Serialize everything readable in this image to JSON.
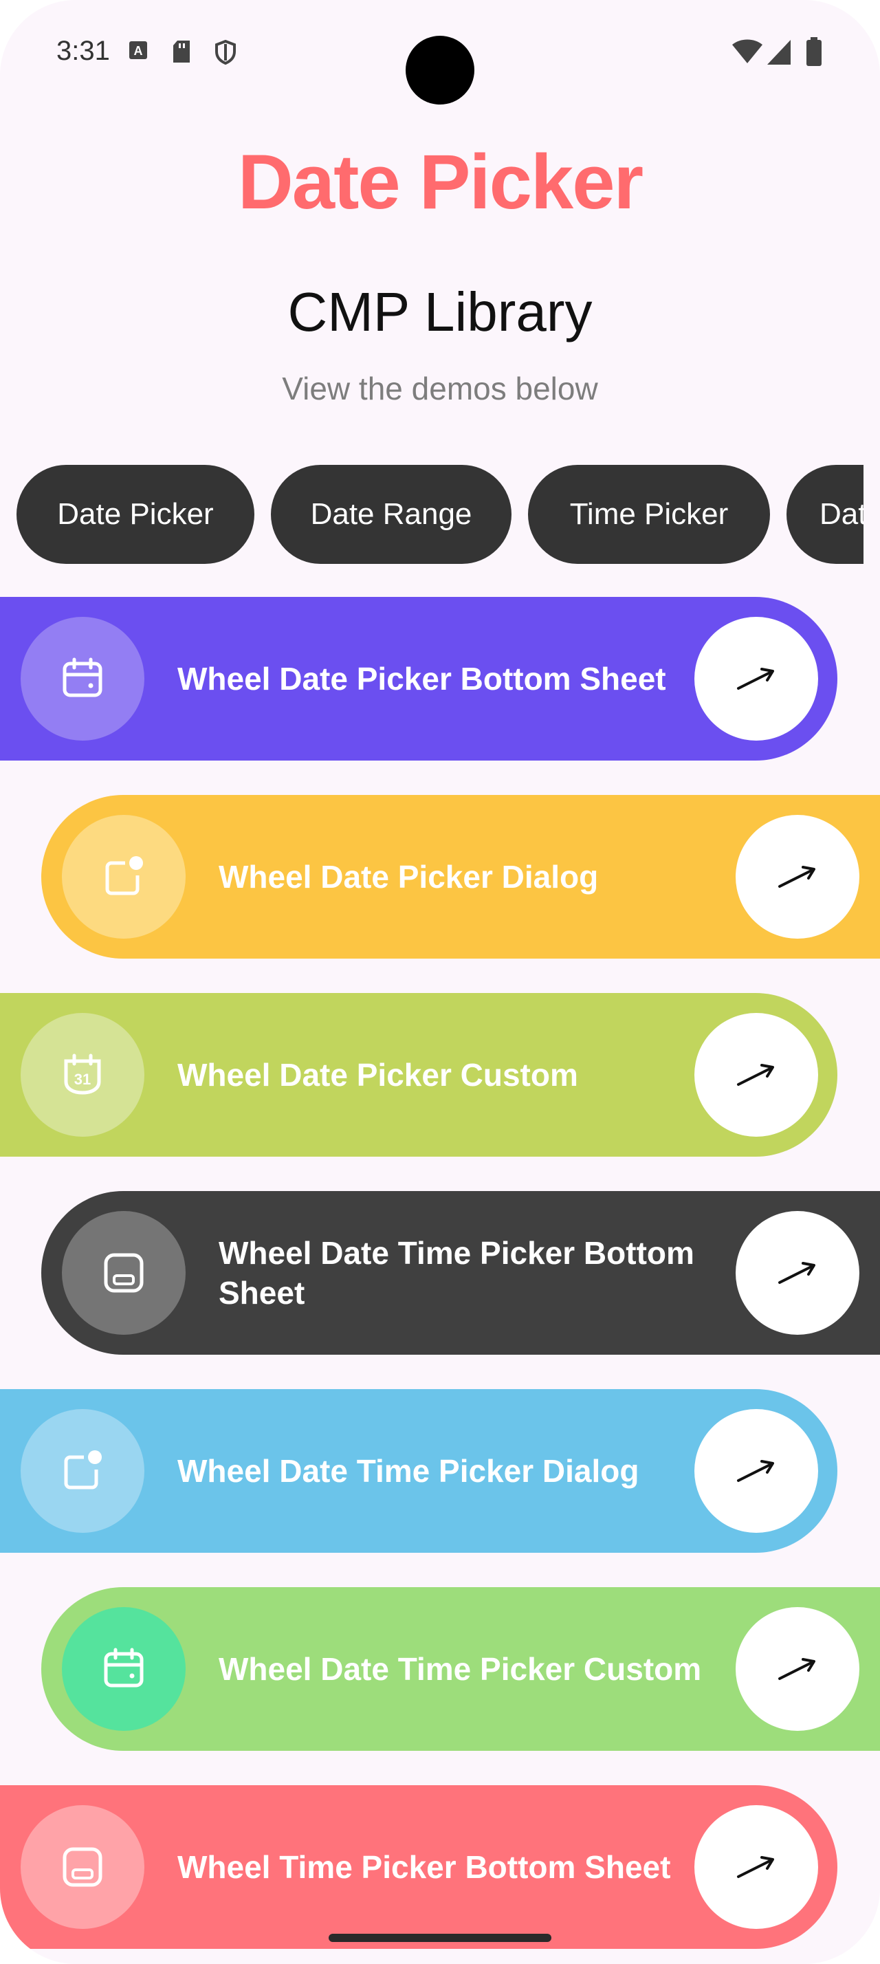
{
  "status_bar": {
    "time": "3:31",
    "icons": [
      "a-badge-icon",
      "sd-card-icon",
      "shield-icon",
      "wifi-icon",
      "signal-icon",
      "battery-icon"
    ]
  },
  "header": {
    "title": "Date Picker",
    "subtitle": "CMP Library",
    "tagline": "View the demos below"
  },
  "chips": [
    {
      "label": "Date Picker"
    },
    {
      "label": "Date Range"
    },
    {
      "label": "Time Picker"
    },
    {
      "label": "Dat"
    }
  ],
  "cards": [
    {
      "label": "Wheel Date Picker Bottom Sheet",
      "icon": "calendar-icon",
      "color": "#6b4ff0",
      "icon_bg": "#937ef3"
    },
    {
      "label": "Wheel Date Picker Dialog",
      "icon": "dialog-icon",
      "color": "#fcc543",
      "icon_bg": "#fdda80"
    },
    {
      "label": "Wheel Date Picker Custom",
      "icon": "calendar-31-icon",
      "color": "#c1d55d",
      "icon_bg": "#d5e395"
    },
    {
      "label": "Wheel Date Time Picker Bottom Sheet",
      "icon": "bottom-sheet-icon",
      "color": "#404040",
      "icon_bg": "#757575"
    },
    {
      "label": "Wheel Date Time Picker Dialog",
      "icon": "dialog-icon",
      "color": "#6bc4ea",
      "icon_bg": "#9ad6f1"
    },
    {
      "label": "Wheel Date Time Picker Custom",
      "icon": "calendar-icon",
      "color": "#9ddd7b",
      "icon_bg": "#55e39d"
    },
    {
      "label": "Wheel Time Picker Bottom Sheet",
      "icon": "bottom-sheet-icon",
      "color": "#ff737b",
      "icon_bg": "#ffa3a8"
    }
  ],
  "arrow_icon": "arrow-up-right-icon"
}
